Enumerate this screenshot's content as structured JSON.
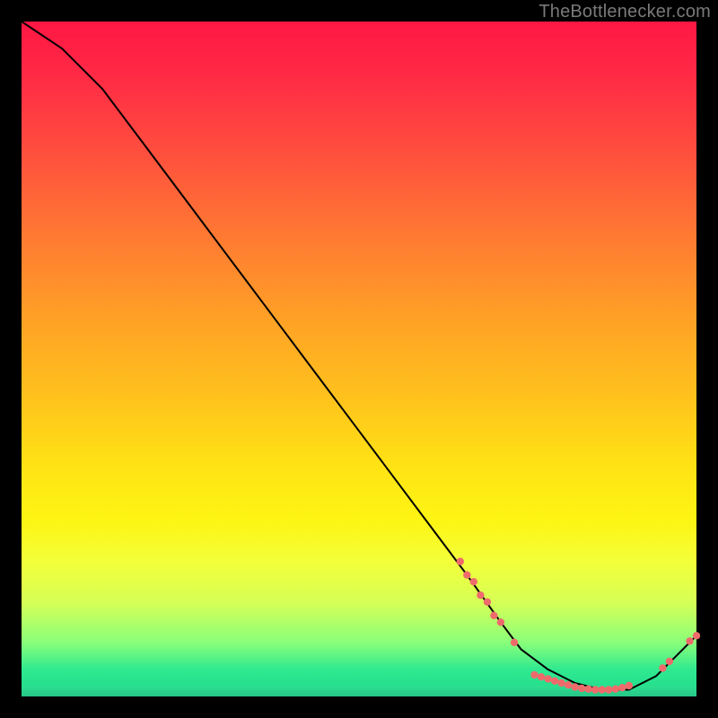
{
  "watermark": "TheBottlenecker.com",
  "accent_dot_color": "#ef6b6b",
  "chart_data": {
    "type": "line",
    "title": "",
    "xlabel": "",
    "ylabel": "",
    "xlim": [
      0,
      100
    ],
    "ylim": [
      0,
      100
    ],
    "x": [
      0,
      6,
      12,
      18,
      24,
      30,
      36,
      42,
      48,
      54,
      60,
      66,
      71,
      74,
      78,
      82,
      86,
      90,
      94,
      97,
      100
    ],
    "values": [
      100,
      96,
      90,
      82,
      74,
      66,
      58,
      50,
      42,
      34,
      26,
      18,
      11,
      7,
      4,
      2,
      1,
      1,
      3,
      6,
      9
    ],
    "annotation_label": "",
    "series_dots": [
      {
        "x": 65,
        "y": 20
      },
      {
        "x": 66,
        "y": 18
      },
      {
        "x": 67,
        "y": 17
      },
      {
        "x": 68,
        "y": 15
      },
      {
        "x": 69,
        "y": 14
      },
      {
        "x": 70,
        "y": 12
      },
      {
        "x": 71,
        "y": 11
      },
      {
        "x": 73,
        "y": 8
      },
      {
        "x": 76,
        "y": 3.2
      },
      {
        "x": 77,
        "y": 2.9
      },
      {
        "x": 78,
        "y": 2.6
      },
      {
        "x": 79,
        "y": 2.3
      },
      {
        "x": 80,
        "y": 2.0
      },
      {
        "x": 81,
        "y": 1.7
      },
      {
        "x": 82,
        "y": 1.4
      },
      {
        "x": 83,
        "y": 1.2
      },
      {
        "x": 84,
        "y": 1.1
      },
      {
        "x": 85,
        "y": 1.0
      },
      {
        "x": 86,
        "y": 1.0
      },
      {
        "x": 87,
        "y": 1.0
      },
      {
        "x": 88,
        "y": 1.1
      },
      {
        "x": 89,
        "y": 1.3
      },
      {
        "x": 90,
        "y": 1.6
      },
      {
        "x": 95,
        "y": 4.2
      },
      {
        "x": 96,
        "y": 5.2
      },
      {
        "x": 99,
        "y": 8.2
      },
      {
        "x": 100,
        "y": 9.0
      }
    ]
  }
}
